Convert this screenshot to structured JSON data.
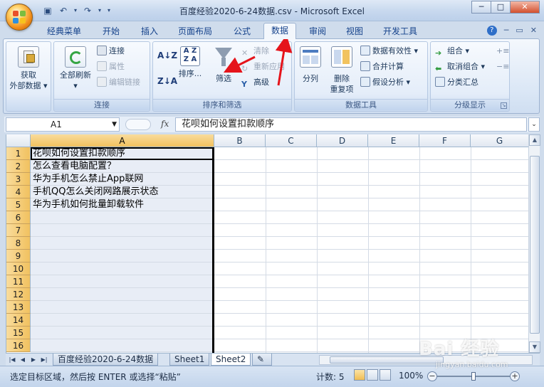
{
  "window": {
    "title": "百度经验2020-6-24数据.csv - Microsoft Excel",
    "buttons": {
      "minimize": "─",
      "maximize": "□",
      "close": "✕"
    }
  },
  "ribbon_tabs": [
    {
      "label": "经典菜单"
    },
    {
      "label": "开始"
    },
    {
      "label": "插入"
    },
    {
      "label": "页面布局"
    },
    {
      "label": "公式"
    },
    {
      "label": "数据",
      "active": true
    },
    {
      "label": "审阅"
    },
    {
      "label": "视图"
    },
    {
      "label": "开发工具"
    }
  ],
  "ribbon": {
    "get_external": {
      "line1": "获取",
      "line2": "外部数据 ▾"
    },
    "connections": {
      "refresh_all": {
        "line1": "全部刷新",
        "line2": "▾"
      },
      "connections": "连接",
      "properties": "属性",
      "edit_links": "编辑链接",
      "group_label": "连接"
    },
    "sort_filter": {
      "sort": "排序...",
      "filter": "筛选",
      "clear": "清除",
      "reapply": "重新应用",
      "advanced": "高级",
      "group_label": "排序和筛选"
    },
    "data_tools": {
      "text_to_columns": "分列",
      "remove_dup_1": "删除",
      "remove_dup_2": "重复项",
      "validation": "数据有效性",
      "consolidate": "合并计算",
      "what_if": "假设分析",
      "group_label": "数据工具"
    },
    "outline": {
      "group": "组合",
      "ungroup": "取消组合",
      "subtotal": "分类汇总",
      "group_label": "分级显示"
    }
  },
  "formula_bar": {
    "name_box": "A1",
    "fx": "fx",
    "content": "花呗如何设置扣款顺序"
  },
  "columns": [
    "A",
    "B",
    "C",
    "D",
    "E",
    "F",
    "G"
  ],
  "rows": [
    "1",
    "2",
    "3",
    "4",
    "5",
    "6",
    "7",
    "8",
    "9",
    "10",
    "11",
    "12",
    "13",
    "14",
    "15",
    "16"
  ],
  "cells_A": [
    "花呗如何设置扣款顺序",
    "怎么查看电脑配置？",
    "华为手机怎么禁止App联网",
    "手机QQ怎么关闭网路展示状态",
    "华为手机如何批量卸载软件"
  ],
  "sheet_tabs": [
    {
      "label": "百度经验2020-6-24数据"
    },
    {
      "label": "Sheet1"
    },
    {
      "label": "Sheet2",
      "active": true
    }
  ],
  "status": {
    "message": "选定目标区域，然后按 ENTER 或选择“粘贴”",
    "count": "计数: 5",
    "zoom": "100%"
  },
  "watermark": {
    "text": "Bai 经验",
    "sub": "jingyan.baidu.com"
  },
  "colors": {
    "accent": "#15428b",
    "arrow": "#e5141b",
    "selected_header": "#f1c15f"
  }
}
